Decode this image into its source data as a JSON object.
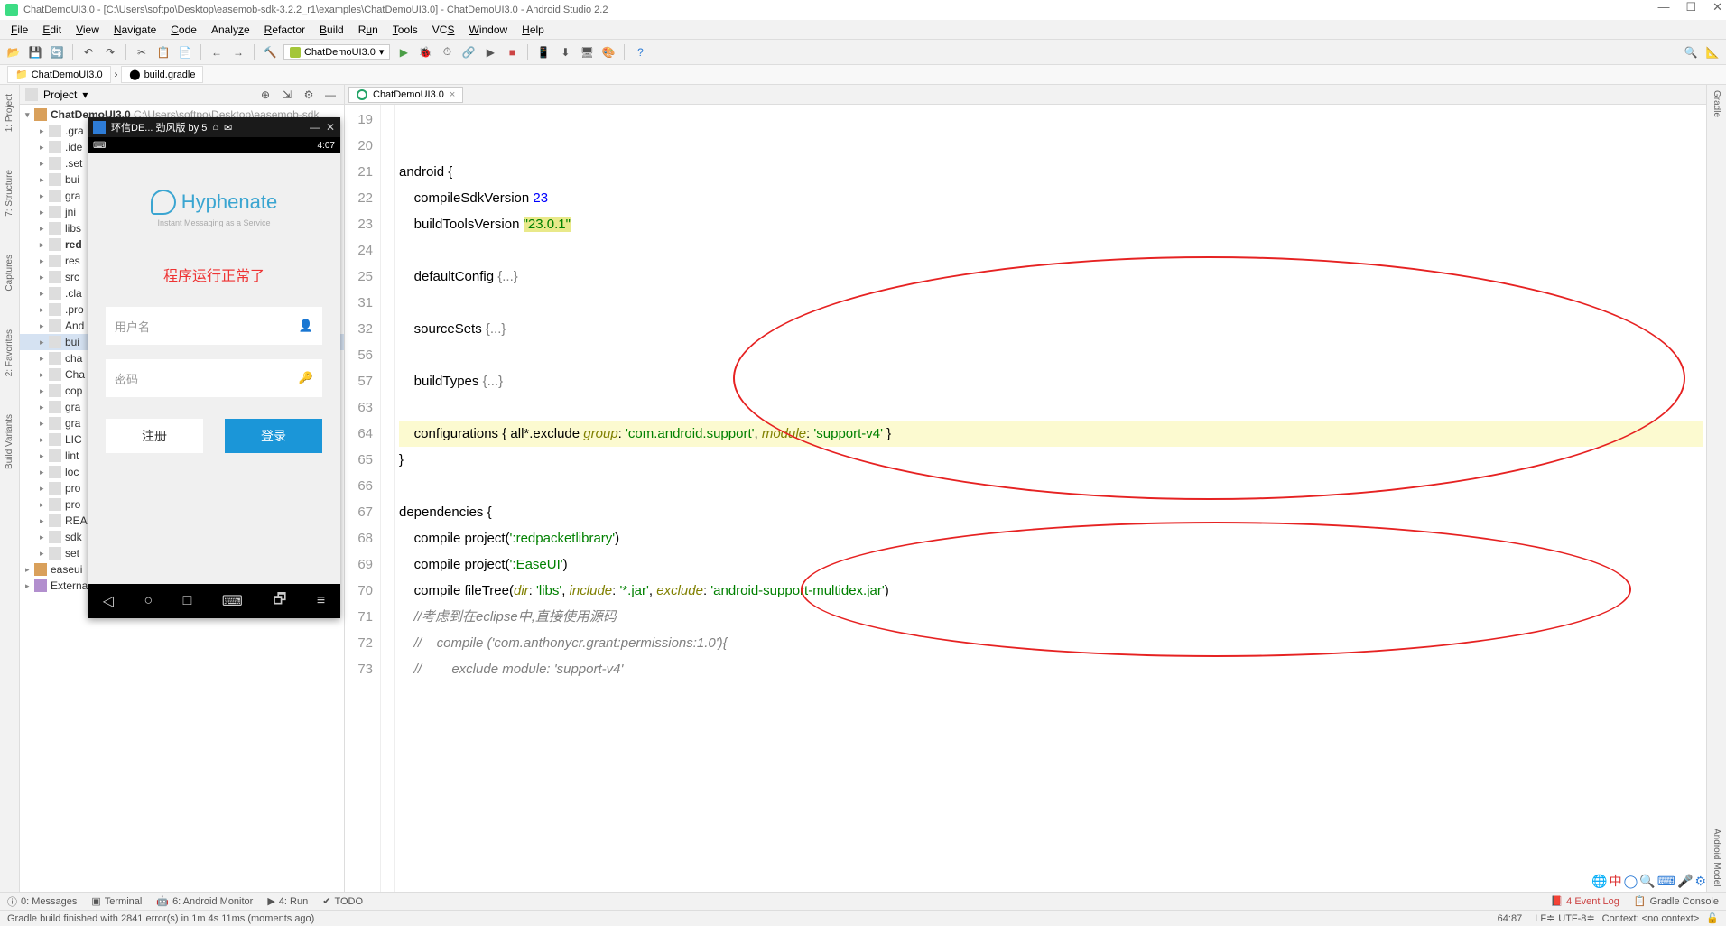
{
  "window": {
    "title": "ChatDemoUI3.0 - [C:\\Users\\softpo\\Desktop\\easemob-sdk-3.2.2_r1\\examples\\ChatDemoUI3.0] - ChatDemoUI3.0 - Android Studio 2.2"
  },
  "menu": [
    "File",
    "Edit",
    "View",
    "Navigate",
    "Code",
    "Analyze",
    "Refactor",
    "Build",
    "Run",
    "Tools",
    "VCS",
    "Window",
    "Help"
  ],
  "runconfig": "ChatDemoUI3.0",
  "breadcrumb": {
    "root": "ChatDemoUI3.0",
    "file": "build.gradle"
  },
  "projectpane": {
    "title": "Project"
  },
  "tree": {
    "root": "ChatDemoUI3.0",
    "rootPath": "C:\\Users\\softpo\\Desktop\\easemob-sdk",
    "items": [
      ".gra",
      ".ide",
      ".set",
      "bui",
      "gra",
      "jni",
      "libs",
      "red",
      "res",
      "src",
      ".cla",
      ".pro",
      "And",
      "bui",
      "cha",
      "Cha",
      "cop",
      "gra",
      "gra",
      "LIC",
      "lint",
      "loc",
      "pro",
      "pro",
      "REA",
      "sdk",
      "set"
    ],
    "extra1": "easeui",
    "extra2": "External Libraries"
  },
  "leftrail": [
    "1: Project",
    "7: Structure",
    "Captures",
    "2: Favorites",
    "Build Variants"
  ],
  "rightrail": [
    "Gradle",
    "Android Model"
  ],
  "editor": {
    "tabname": "ChatDemoUI3.0",
    "lines": [
      "19",
      "20",
      "21",
      "22",
      "23",
      "24",
      "25",
      "31",
      "32",
      "56",
      "57",
      "63",
      "64",
      "65",
      "66",
      "67",
      "68",
      "69",
      "70",
      "71",
      "72",
      "73"
    ],
    "code": {
      "l21": "android {",
      "l22a": "    compileSdkVersion ",
      "l22b": "23",
      "l23a": "    buildToolsVersion ",
      "l23b": "\"23.0.1\"",
      "l25a": "    defaultConfig ",
      "l25b": "{...}",
      "l32a": "    sourceSets ",
      "l32b": "{...}",
      "l57a": "    buildTypes ",
      "l57b": "{...}",
      "l64a": "    configurations { all*.exclude ",
      "l64b": "group",
      "l64c": ": ",
      "l64d": "'com.android.support'",
      "l64e": ", ",
      "l64f": "module",
      "l64g": ": ",
      "l64h": "'support-v4'",
      "l64i": " }",
      "l65": "}",
      "l67": "dependencies {",
      "l68a": "    compile project(",
      "l68b": "':redpacketlibrary'",
      "l68c": ")",
      "l69a": "    compile project(",
      "l69b": "':EaseUI'",
      "l69c": ")",
      "l70a": "    compile fileTree(",
      "l70b": "dir",
      "l70c": ": ",
      "l70d": "'libs'",
      "l70e": ", ",
      "l70f": "include",
      "l70g": ": ",
      "l70h": "'*.jar'",
      "l70i": ", ",
      "l70j": "exclude",
      "l70k": ": ",
      "l70l": "'android-support-multidex.jar'",
      "l70m": ")",
      "l71": "    //考虑到在eclipse中,直接使用源码",
      "l72": "    //    compile ('com.anthonycr.grant:permissions:1.0'){",
      "l73": "    //        exclude module: 'support-v4'"
    }
  },
  "emulator": {
    "title": "环信DE... 劲风版 by 5",
    "time": "4:07",
    "brand": "Hyphenate",
    "sub": "Instant Messaging as a Service",
    "msg": "程序运行正常了",
    "user_ph": "用户名",
    "pass_ph": "密码",
    "register": "注册",
    "login": "登录"
  },
  "bottombar": {
    "messages": "0: Messages",
    "terminal": "Terminal",
    "android": "6: Android Monitor",
    "run": "4: Run",
    "todo": "TODO",
    "eventlog": "4 Event Log",
    "gradleconsole": "Gradle Console"
  },
  "status": {
    "msg": "Gradle build finished with 2841 error(s) in 1m 4s 11ms (moments ago)",
    "pos": "64:87",
    "le": "LF",
    "enc": "UTF-8",
    "ctx": "Context: <no context>"
  }
}
